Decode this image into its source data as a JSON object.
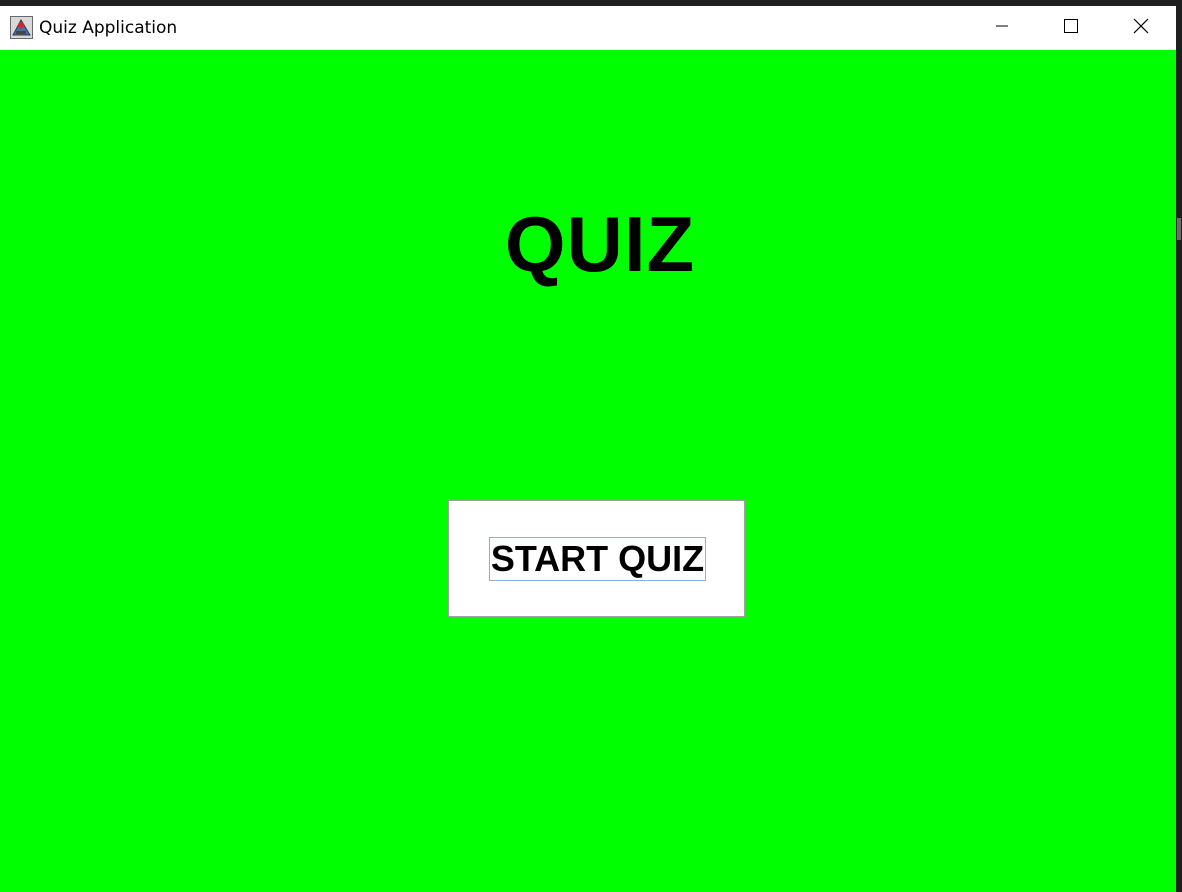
{
  "window": {
    "title": "Quiz Application",
    "controls": {
      "minimize_icon": "minimize-icon",
      "maximize_icon": "maximize-icon",
      "close_icon": "close-icon"
    }
  },
  "main": {
    "heading": "QUIZ",
    "start_button_label": "START QUIZ"
  },
  "colors": {
    "background": "#00ff00",
    "titlebar": "#ffffff",
    "text": "#000000",
    "button_background": "#ffffff",
    "focus_ring": "#8fb0d0"
  }
}
